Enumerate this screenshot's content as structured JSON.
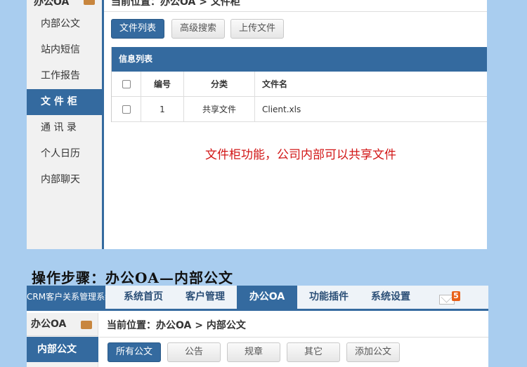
{
  "top": {
    "sidebar": {
      "title": "办公OA",
      "items": [
        {
          "label": "内部公文"
        },
        {
          "label": "站内短信"
        },
        {
          "label": "工作报告"
        },
        {
          "label": "文 件 柜"
        },
        {
          "label": "通 讯 录"
        },
        {
          "label": "个人日历"
        },
        {
          "label": "内部聊天"
        }
      ],
      "active_index": 3
    },
    "breadcrumb": "当前位置：办公OA > 文件柜",
    "buttons": {
      "list": "文件列表",
      "search": "高级搜索",
      "upload": "上传文件"
    },
    "table": {
      "title": "信息列表",
      "headers": {
        "num": "编号",
        "category": "分类",
        "filename": "文件名"
      },
      "rows": [
        {
          "num": "1",
          "category": "共享文件",
          "filename": "Client.xls"
        }
      ]
    },
    "note": "文件柜功能，公司内部可以共享文件"
  },
  "caption": "操作步骤：办公OA—内部公文",
  "bottom": {
    "brand": "CRM客户关系管理系统",
    "nav": [
      "系统首页",
      "客户管理",
      "办公OA",
      "功能插件",
      "系统设置"
    ],
    "nav_active_index": 2,
    "mail_count": "5",
    "sidebar": {
      "title": "办公OA",
      "active_item": "内部公文"
    },
    "breadcrumb": "当前位置：办公OA > 内部公文",
    "buttons": {
      "all": "所有公文",
      "notice": "公告",
      "rules": "规章",
      "other": "其它",
      "add": "添加公文"
    }
  },
  "colors": {
    "accent": "#346a9f",
    "background": "#a9cdef",
    "note": "#d21616",
    "badge": "#e8611a"
  }
}
